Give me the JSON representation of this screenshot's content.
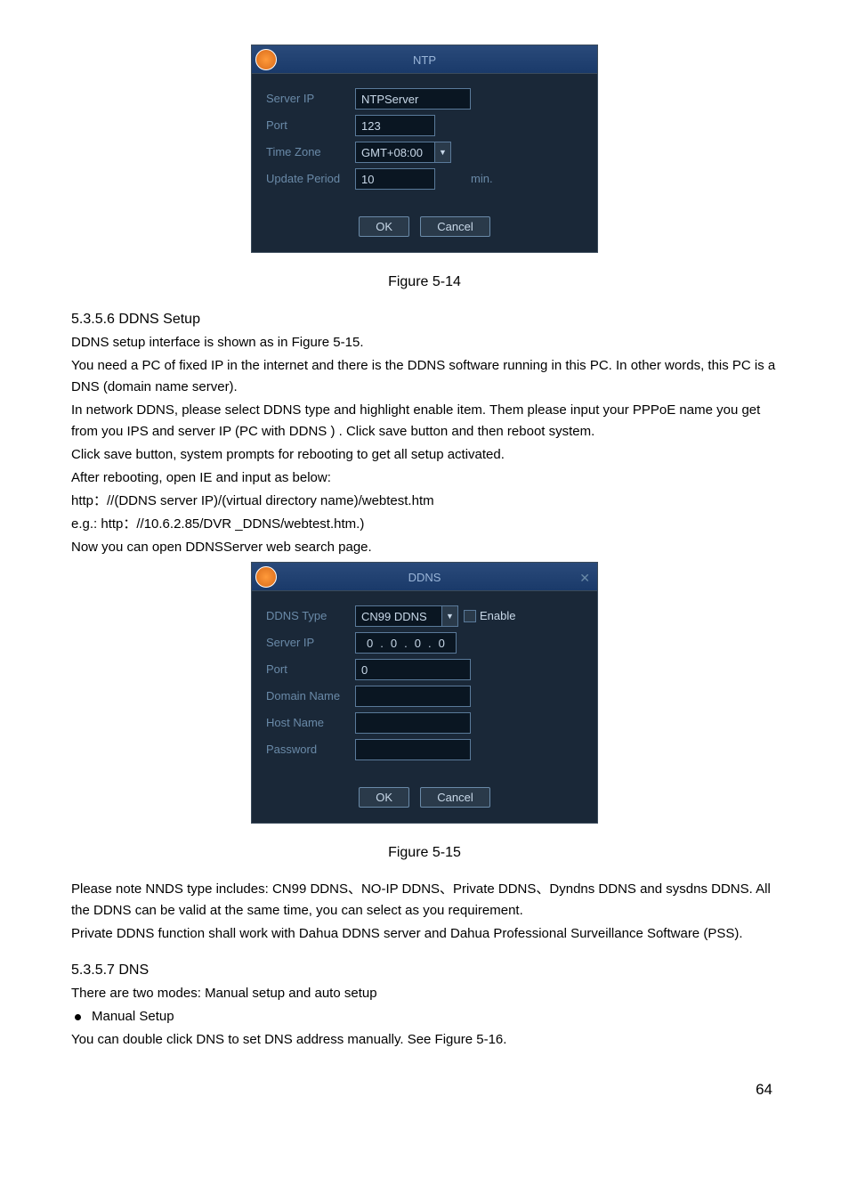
{
  "ntp_dialog": {
    "title": "NTP",
    "server_ip_label": "Server IP",
    "server_ip_value": "NTPServer",
    "port_label": "Port",
    "port_value": "123",
    "timezone_label": "Time Zone",
    "timezone_value": "GMT+08:00",
    "update_label": "Update Period",
    "update_value": "10",
    "update_unit": "min.",
    "ok_label": "OK",
    "cancel_label": "Cancel"
  },
  "figure1_caption": "Figure 5-14",
  "section1_heading": "5.3.5.6  DDNS Setup",
  "section1_text": [
    "DDNS setup interface is shown as in Figure 5-15.",
    "You need a PC of fixed IP in the internet and there is the DDNS software running in this PC. In other words, this PC is a DNS (domain name server).",
    "In network DDNS, please select DDNS type and highlight enable item. Them please input your PPPoE name you get from you IPS and server IP (PC with DDNS ) . Click save button and then reboot system.",
    "Click save button, system prompts for rebooting to get all setup activated.",
    "After rebooting, open IE and input as below:",
    "http：//(DDNS server IP)/(virtual directory name)/webtest.htm",
    "e.g.: http：//10.6.2.85/DVR _DDNS/webtest.htm.)",
    "Now you can open DDNSServer web search page."
  ],
  "ddns_dialog": {
    "title": "DDNS",
    "type_label": "DDNS Type",
    "type_value": "CN99 DDNS",
    "enable_label": "Enable",
    "server_ip_label": "Server IP",
    "ip_segs": [
      "0",
      "0",
      "0",
      "0"
    ],
    "port_label": "Port",
    "port_value": "0",
    "domain_label": "Domain Name",
    "domain_value": "",
    "host_label": "Host Name",
    "host_value": "",
    "password_label": "Password",
    "password_value": "",
    "ok_label": "OK",
    "cancel_label": "Cancel"
  },
  "figure2_caption": "Figure 5-15",
  "section2_text": [
    "Please note NNDS type includes: CN99 DDNS、NO-IP DDNS、Private DDNS、Dyndns DDNS and sysdns DDNS. All the DDNS can be valid at the same time, you can select as you requirement.",
    "Private DDNS function shall work with Dahua DDNS server and Dahua Professional Surveillance Software (PSS)."
  ],
  "section3_heading": "5.3.5.7  DNS",
  "section3_text1": "There are two modes: Manual setup and auto setup",
  "section3_bullet": "Manual Setup",
  "section3_text2": "You can double click DNS to set DNS address manually. See Figure 5-16.",
  "page_number": "64"
}
